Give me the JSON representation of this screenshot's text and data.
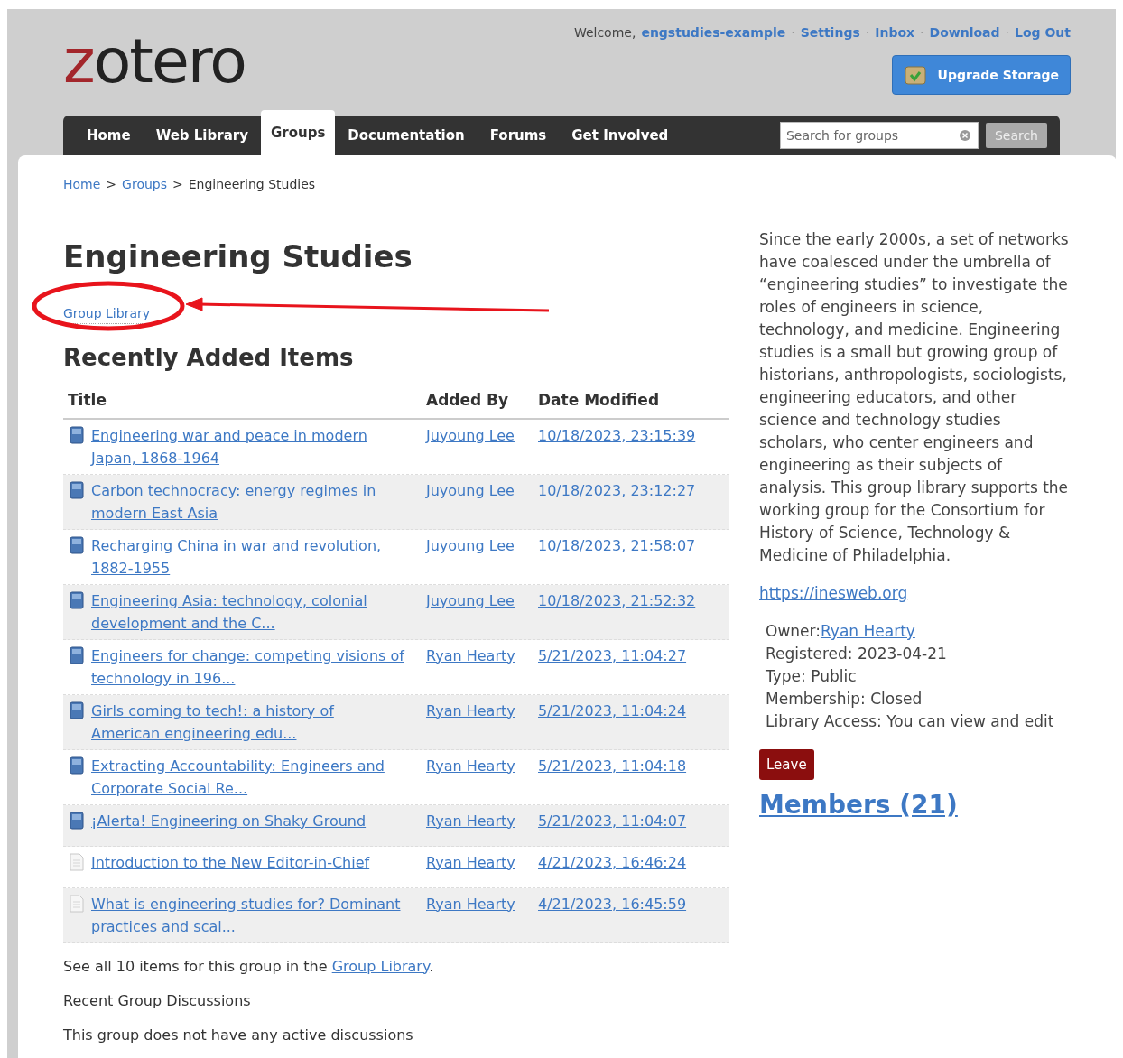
{
  "logo": {
    "accent": "z",
    "text": "otero"
  },
  "account": {
    "welcome": "Welcome,",
    "username": "engstudies-example",
    "separator": "·",
    "links": [
      "Settings",
      "Inbox",
      "Download",
      "Log Out"
    ]
  },
  "upgrade_button": "Upgrade Storage",
  "nav": {
    "tabs": [
      {
        "label": "Home",
        "selected": false
      },
      {
        "label": "Web Library",
        "selected": false
      },
      {
        "label": "Groups",
        "selected": true
      },
      {
        "label": "Documentation",
        "selected": false
      },
      {
        "label": "Forums",
        "selected": false
      },
      {
        "label": "Get Involved",
        "selected": false
      }
    ],
    "search": {
      "placeholder": "Search for groups",
      "button": "Search"
    }
  },
  "breadcrumb": {
    "links": [
      "Home",
      "Groups"
    ],
    "separator": ">",
    "current": "Engineering Studies"
  },
  "title": "Engineering Studies",
  "library_link": "Group Library",
  "recent_heading": "Recently Added Items",
  "table": {
    "columns": [
      "Title",
      "Added By",
      "Date Modified"
    ],
    "rows": [
      {
        "kind": "book",
        "title": "Engineering war and peace in modern Japan, 1868-1964",
        "added_by": "Juyoung Lee",
        "date": "10/18/2023, 23:15:39"
      },
      {
        "kind": "book",
        "title": "Carbon technocracy: energy regimes in modern East Asia",
        "added_by": "Juyoung Lee",
        "date": "10/18/2023, 23:12:27"
      },
      {
        "kind": "book",
        "title": "Recharging China in war and revolution, 1882-1955",
        "added_by": "Juyoung Lee",
        "date": "10/18/2023, 21:58:07"
      },
      {
        "kind": "book",
        "title": "Engineering Asia: technology, colonial development and the C...",
        "added_by": "Juyoung Lee",
        "date": "10/18/2023, 21:52:32"
      },
      {
        "kind": "book",
        "title": "Engineers for change: competing visions of technology in 196...",
        "added_by": "Ryan Hearty",
        "date": "5/21/2023, 11:04:27"
      },
      {
        "kind": "book",
        "title": "Girls coming to tech!: a history of American engineering edu...",
        "added_by": "Ryan Hearty",
        "date": "5/21/2023, 11:04:24"
      },
      {
        "kind": "book",
        "title": "Extracting Accountability: Engineers and Corporate Social Re...",
        "added_by": "Ryan Hearty",
        "date": "5/21/2023, 11:04:18"
      },
      {
        "kind": "book",
        "title": "¡Alerta! Engineering on Shaky Ground",
        "added_by": "Ryan Hearty",
        "date": "5/21/2023, 11:04:07"
      },
      {
        "kind": "document",
        "title": "Introduction to the New Editor-in-Chief",
        "added_by": "Ryan Hearty",
        "date": "4/21/2023, 16:46:24"
      },
      {
        "kind": "document",
        "title": "What is engineering studies for? Dominant practices and scal...",
        "added_by": "Ryan Hearty",
        "date": "4/21/2023, 16:45:59"
      }
    ]
  },
  "see_all": {
    "text": "See all 10 items for this group in the",
    "link": "Group Library",
    "end": "."
  },
  "discussions_heading": "Recent Group Discussions",
  "discussions_note": "This group does not have any active discussions",
  "description": "Since the early 2000s, a set of networks have coalesced under the umbrella of “engineering studies” to investigate the roles of engineers in science, technology, and medicine. Engineering studies is a small but growing group of historians, anthropologists, sociologists, engineering educators, and other science and technology studies scholars, who center engineers and engineering as their subjects of analysis. This group library supports the working group for the Consortium for History of Science, Technology & Medicine of Philadelphia.",
  "website": "https://inesweb.org",
  "owner": {
    "label": "Owner:",
    "name": "Ryan Hearty"
  },
  "details": [
    "Registered: 2023-04-21",
    "Type: Public",
    "Membership: Closed",
    "Library Access: You can view and edit"
  ],
  "leave_button": "Leave",
  "members_link": "Members (21)"
}
